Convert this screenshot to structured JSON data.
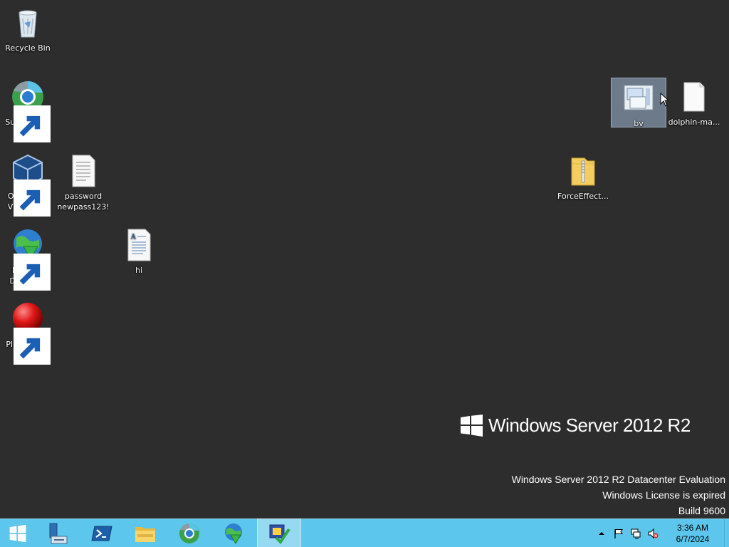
{
  "desktop": {
    "icons": {
      "recycle_bin": "Recycle Bin",
      "supermium": "Supermium",
      "virtualbox": "Oracle VM VirtualBox",
      "password": "password newpass123!",
      "internet_download": "Internet Downlo...",
      "hi": "hi",
      "platfos": "PlatfOS Pre Beta",
      "bv": "bv",
      "dolphin": "dolphin-ma...",
      "forceeffect": "ForceEffect..."
    }
  },
  "branding": {
    "name": "Windows Server 2012 R2"
  },
  "watermark": {
    "line1": "Windows Server 2012 R2 Datacenter Evaluation",
    "line2": "Windows License is expired",
    "line3": "Build 9600"
  },
  "taskbar": {
    "clock_time": "3:36 AM",
    "clock_date": "6/7/2024",
    "accent_color": "#5cc6ec"
  },
  "icon_names": [
    "start-icon",
    "server-manager-icon",
    "powershell-icon",
    "file-explorer-icon",
    "supermium-icon",
    "internet-download-manager-icon",
    "active-app-icon",
    "show-hidden-icons",
    "action-center-flag-icon",
    "network-icon",
    "volume-muted-icon"
  ]
}
